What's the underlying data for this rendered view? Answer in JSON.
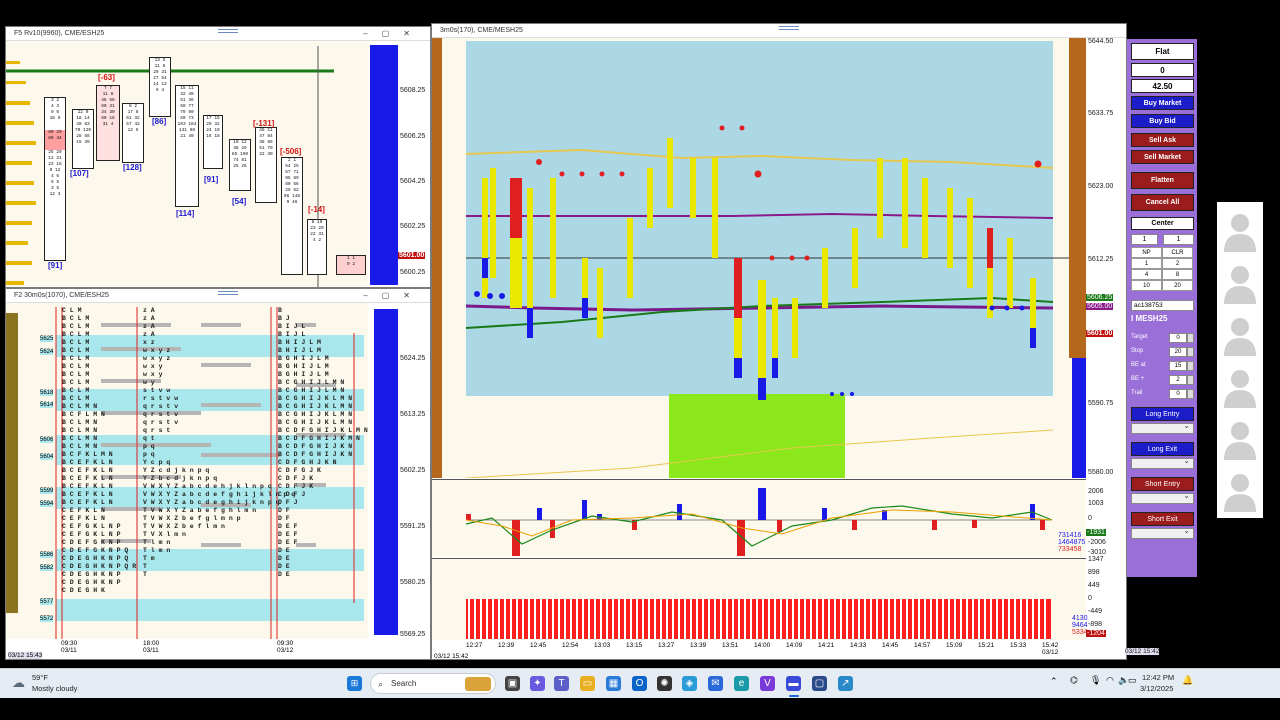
{
  "top_left_window": {
    "title": "F5 Rv10(9960), CME/ESH25",
    "price_ticks": [
      "5608.25",
      "5606.25",
      "5604.25",
      "5602.25",
      "5601.00",
      "5600.25"
    ],
    "delta_labels": [
      "[-63]",
      "[86]",
      "[107]",
      "[128]",
      "[-131]",
      "[91]",
      "[114]",
      "[54]",
      "[-506]",
      "[-14]",
      "[91]"
    ],
    "current_price": "5601.00"
  },
  "bottom_left_window": {
    "title": "F2 30m0s(1070), CME/ESH25",
    "price_ticks": [
      "5624.25",
      "5613.25",
      "5602.25",
      "5591.25",
      "5580.25",
      "5569.25"
    ],
    "left_levels": [
      "5625",
      "5624",
      "5618",
      "5614",
      "5606",
      "5604",
      "5599",
      "5594",
      "5586",
      "5582",
      "5577",
      "5572"
    ],
    "time_labels": [
      "09:30\n03/11",
      "18:00\n03/11",
      "09:30\n03/12"
    ],
    "status": "03/12 15:43",
    "tpo_col1": "C L M\nB C L M\nB C L M\nB C L M\nB C L M\nB C L M\nB C L M\nB C L M\nB C L M\nB C L M\nB C L M\nB C L M\nB C L M N\nB C F L M N\nB C L M N\nB C L M N\nB C L M N\nB C L M N\nB C F K L M N\nB C E F K L N\nB C E F K L N\nB C E F K L N\nB C E F K L N\nB C E F K L N\nB C E F K L N\nC E F K L N\nC E F K L N\nC E F G K L N P\nC E F G K L N P\nC D E F G K N P\nC D E F G K N P Q\nC D E G H K N P Q\nC D E G H K N P Q R\nC D E G H K N P\nC D E G H K N P\nC D E G H K",
    "tpo_col2": "z A\nz A\nz A\nz A\nx z\nw x y z\nw x y z\nw x y\nw x y\nw y\ns t v w\nr s t v w\nq r s t v\nq r s t v\nq r s t v\nq r s t\nq t\np q\np q\nY c p q\nY Z c d j k n p q\nY Z b c d j k n p q\nV W X Y Z a b c d e h j k l n p q\nV W X Y Z a b c d e f g h i j k l n p q\nV W X Y Z a b c d e g h i j k n p q\nT V W X Y Z a b e f g h l m n\nT V W X Z b e f g l m n p\nT V W X Z b e f l m n\nT V X l m n\nT l m n\nT l m n\nT m\nT\nT",
    "tpo_col3": "B\nB J\nB I J L\nB I J L\nB H I J L M\nB H I J L M\nB G H I J L M\nB G H I J L M\nB G H I J L M\nB C G H I J L M N\nB C G H I J L M N\nB C G H I J K L M N\nB C G H I J K L M N\nB C G H I J K L M N\nB C G H I J K L M N\nB C D F G H I J K L M N\nB C D F G H I J K M N\nB C D F G H I J K N\nB C D F G H I J K N\nC D F G H J K N\nC D F G J K\nC D F J K\nC D F J K\nC D F J\nD F J\nD F\nD F\nD E F\nD E F\nD E F\nD E\nD E\nD E\nD E"
  },
  "main_window": {
    "title": "3m0s(170), CME/MESH25",
    "price_ticks": [
      "5644.50",
      "5633.75",
      "5623.00",
      "5612.25",
      "5606.25",
      "5605.00",
      "5601.00",
      "5590.75",
      "5580.00"
    ],
    "time_labels": [
      "12:27",
      "12:39",
      "12:45",
      "12:54",
      "13:03",
      "13:15",
      "13:27",
      "13:39",
      "13:51",
      "14:00",
      "14:09",
      "14:21",
      "14:33",
      "14:45",
      "14:57",
      "15:09",
      "15:21",
      "15:33",
      "15:42\n03/12"
    ],
    "indicator_ticks": [
      "2006",
      "1003",
      "0",
      "-1003",
      "-2006",
      "-3010"
    ],
    "indicator_values": [
      "731416",
      "1464875",
      "733458"
    ],
    "indicator_highlight": "-1931",
    "volume_ticks": [
      "1347",
      "898",
      "449",
      "0",
      "-449",
      "-898",
      "-1347"
    ],
    "volume_values": [
      "4130",
      "9464",
      "5334"
    ],
    "volume_highlight": "-1204",
    "status": "03/12 15:42"
  },
  "ladder": {
    "position": "Flat",
    "qty": "0",
    "price": "42.50",
    "buy_market": "Buy Market",
    "buy_bid": "Buy Bid",
    "sell_ask": "Sell Ask",
    "sell_market": "Sell Market",
    "flatten": "Flatten",
    "cancel_all": "Cancel All",
    "center": "Center",
    "qty_input": "1",
    "qty_grid": [
      "NP",
      "CLR",
      "1",
      "2",
      "4",
      "8",
      "10",
      "20"
    ],
    "qty_top_right": "1",
    "account": "ac138753",
    "symbol": "MESH25",
    "target_label": "Target",
    "target_val": "0",
    "stop_label": "Stop",
    "stop_val": "20",
    "be_at_label": "BE at",
    "be_at_val": "15",
    "be_plus_label": "BE +",
    "be_plus_val": "2",
    "trail_label": "Trail",
    "trail_val": "0",
    "long_entry": "Long Entry",
    "long_exit": "Long Exit",
    "short_entry": "Short Entry",
    "short_exit": "Short Exit",
    "colors": {
      "blue": "#1c1cc8",
      "red": "#9b1c1c",
      "panel": "#9b6fd8"
    }
  },
  "taskbar": {
    "weather_temp": "59°F",
    "weather_desc": "Mostly cloudy",
    "search_placeholder": "Search",
    "time": "12:42 PM",
    "date": "3/12/2025"
  }
}
